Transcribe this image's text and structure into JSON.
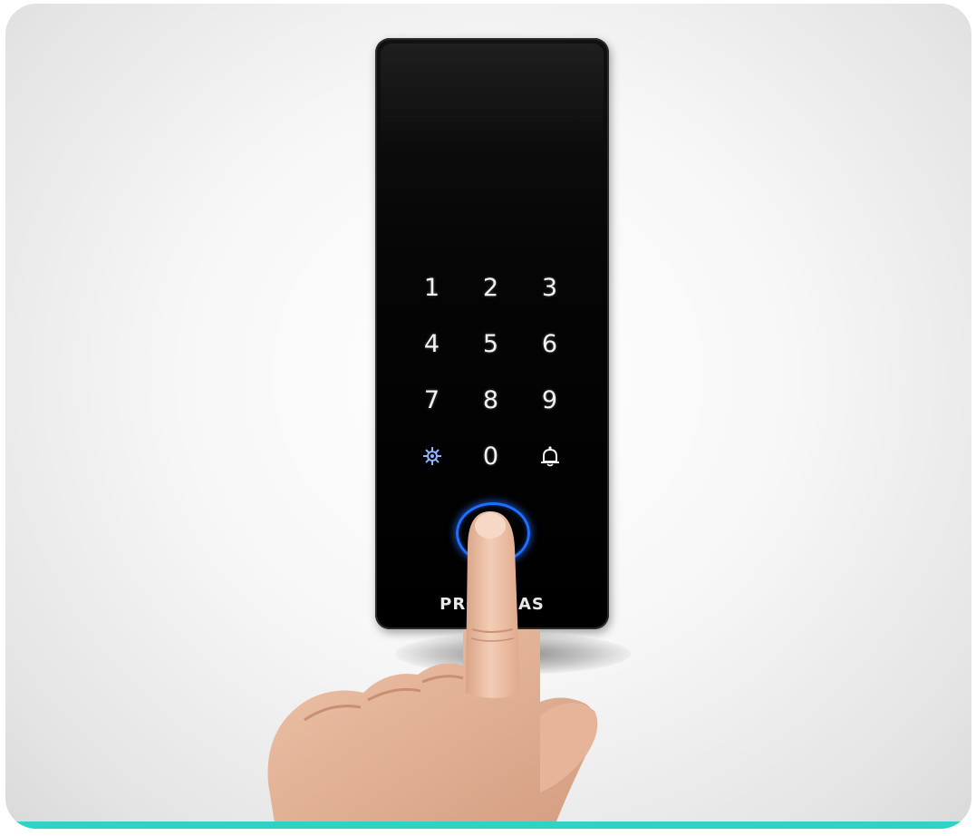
{
  "device": {
    "keys": [
      "1",
      "2",
      "3",
      "4",
      "5",
      "6",
      "7",
      "8",
      "9",
      "",
      "0",
      ""
    ],
    "left_function_icon": "gear-icon",
    "right_function_icon": "bell-icon",
    "brand_text": "PROTERAS",
    "fingerprint_light_color": "#1f6fff"
  },
  "colors": {
    "bottom_accent": "#2ed3c4",
    "device_body": "#000000"
  }
}
